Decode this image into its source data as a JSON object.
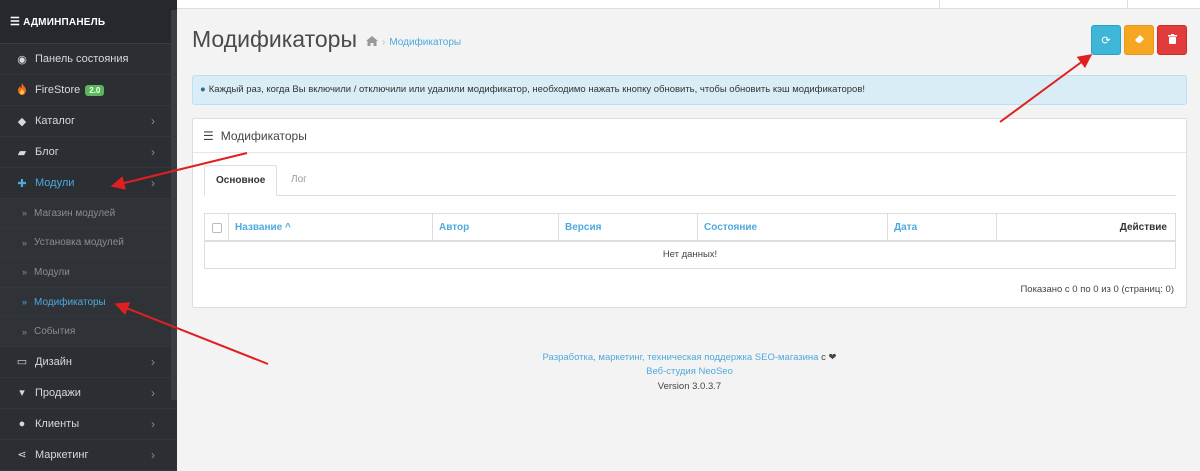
{
  "sidebar": {
    "header": "АДМИНПАНЕЛЬ",
    "items": [
      {
        "label": "Панель состояния",
        "icon": "dashboard-icon"
      },
      {
        "label": "FireStore",
        "icon": "fire-icon",
        "badge": "2.0"
      },
      {
        "label": "Каталог",
        "icon": "tag-icon"
      },
      {
        "label": "Блог",
        "icon": "book-icon"
      },
      {
        "label": "Модули",
        "icon": "puzzle-icon"
      },
      {
        "label": "Дизайн",
        "icon": "monitor-icon"
      },
      {
        "label": "Продажи",
        "icon": "cart-icon"
      },
      {
        "label": "Клиенты",
        "icon": "user-icon"
      },
      {
        "label": "Маркетинг",
        "icon": "share-icon"
      }
    ],
    "subitems": [
      {
        "label": "Магазин модулей"
      },
      {
        "label": "Установка модулей"
      },
      {
        "label": "Модули"
      },
      {
        "label": "Модификаторы"
      },
      {
        "label": "События"
      }
    ]
  },
  "page": {
    "title": "Модификаторы",
    "breadcrumb": "Модификаторы"
  },
  "alert": {
    "text": "Каждый раз, когда Вы включили / отключили или удалили модификатор, необходимо нажать кнопку обновить, чтобы обновить кэш модификаторов!"
  },
  "panel": {
    "title": "Модификаторы",
    "tabs": [
      {
        "label": "Основное"
      },
      {
        "label": "Лог"
      }
    ],
    "table": {
      "columns": [
        "Название",
        "Автор",
        "Версия",
        "Состояние",
        "Дата",
        "Действие"
      ],
      "sort_indicator": "^",
      "empty": "Нет данных!"
    },
    "pager": "Показано с 0 по 0 из 0 (страниц: 0)"
  },
  "footer": {
    "line1_link": "Разработка, маркетинг, техническая поддержка SEO-магазина",
    "line1_suffix": "с ❤",
    "line2_link": "Веб-студия NeoSeo",
    "version": "Version 3.0.3.7"
  },
  "colors": {
    "sidebar_bg": "#2b2e33",
    "accent": "#4fa9dd",
    "refresh": "#3fb5d8",
    "clear": "#f5a623",
    "delete": "#e23b3b",
    "alert_bg": "#d9edf7",
    "annotation_arrow": "#e02020"
  }
}
